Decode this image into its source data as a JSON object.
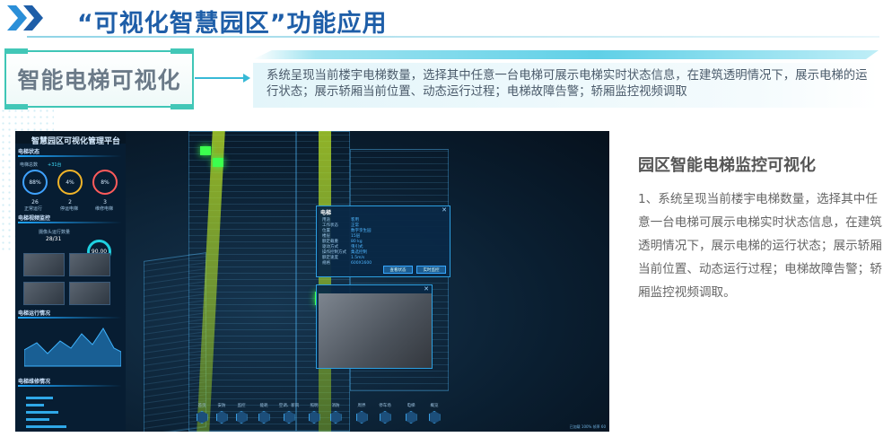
{
  "header": {
    "title": "“可视化智慧园区”功能应用",
    "accent_color": "#1e5ea8"
  },
  "feature": {
    "label": "智能电梯可视化",
    "description": "系统呈现当前楼宇电梯数量，选择其中任意一台电梯可展示电梯实时状态信息，在建筑透明情况下，展示电梯的运行状态；展示轿厢当前位置、动态运行过程；电梯故障告警；轿厢监控视频调取"
  },
  "dashboard": {
    "platform_title": "智慧园区可视化管理平台",
    "left_panel": {
      "sec_status": "电梯状态",
      "total_label": "电梯总数",
      "total_value": "+31台",
      "rings": [
        {
          "value": "88%",
          "count": "26",
          "label": "正常运行"
        },
        {
          "value": "4%",
          "count": "2",
          "label": "停运电梯"
        },
        {
          "value": "8%",
          "count": "3",
          "label": "维修电梯"
        }
      ],
      "sec_video": "电梯视频监控",
      "cam_label": "摄像头运行数量",
      "cam_value": "28/31",
      "gauge_value": "90.00",
      "sec_run": "电梯运行情况",
      "sec_repair": "电梯维修情况"
    },
    "info_card": {
      "title": "电梯",
      "rows": [
        {
          "k": "用途",
          "v": "客用"
        },
        {
          "k": "工作状态",
          "v": "正常"
        },
        {
          "k": "位置",
          "v": "数字孪生园"
        },
        {
          "k": "楼层",
          "v": "15层"
        },
        {
          "k": "额定载重",
          "v": "80 kg"
        },
        {
          "k": "驱动方式",
          "v": "曳引式"
        },
        {
          "k": "操作控制方式",
          "v": "集选控制"
        },
        {
          "k": "额定速度",
          "v": "1.5m/s"
        },
        {
          "k": "规格",
          "v": "600X1600"
        }
      ],
      "btn_status": "查看状态",
      "btn_monitor": "实时监控"
    },
    "toolbar": [
      "首页",
      "安防",
      "监控",
      "能耗",
      "空调、新风",
      "照明",
      "消防",
      "周界",
      "停车场",
      "电梯",
      "概览"
    ],
    "status_line": "已加载 100% 帧率 60"
  },
  "right_column": {
    "heading": "园区智能电梯监控可视化",
    "body": "1、系统呈现当前楼宇电梯数量，选择其中任意一台电梯可展示电梯实时状态信息，在建筑透明情况下，展示电梯的运行状态；展示轿厢当前位置、动态运行过程；电梯故障告警；轿厢监控视频调取。"
  }
}
